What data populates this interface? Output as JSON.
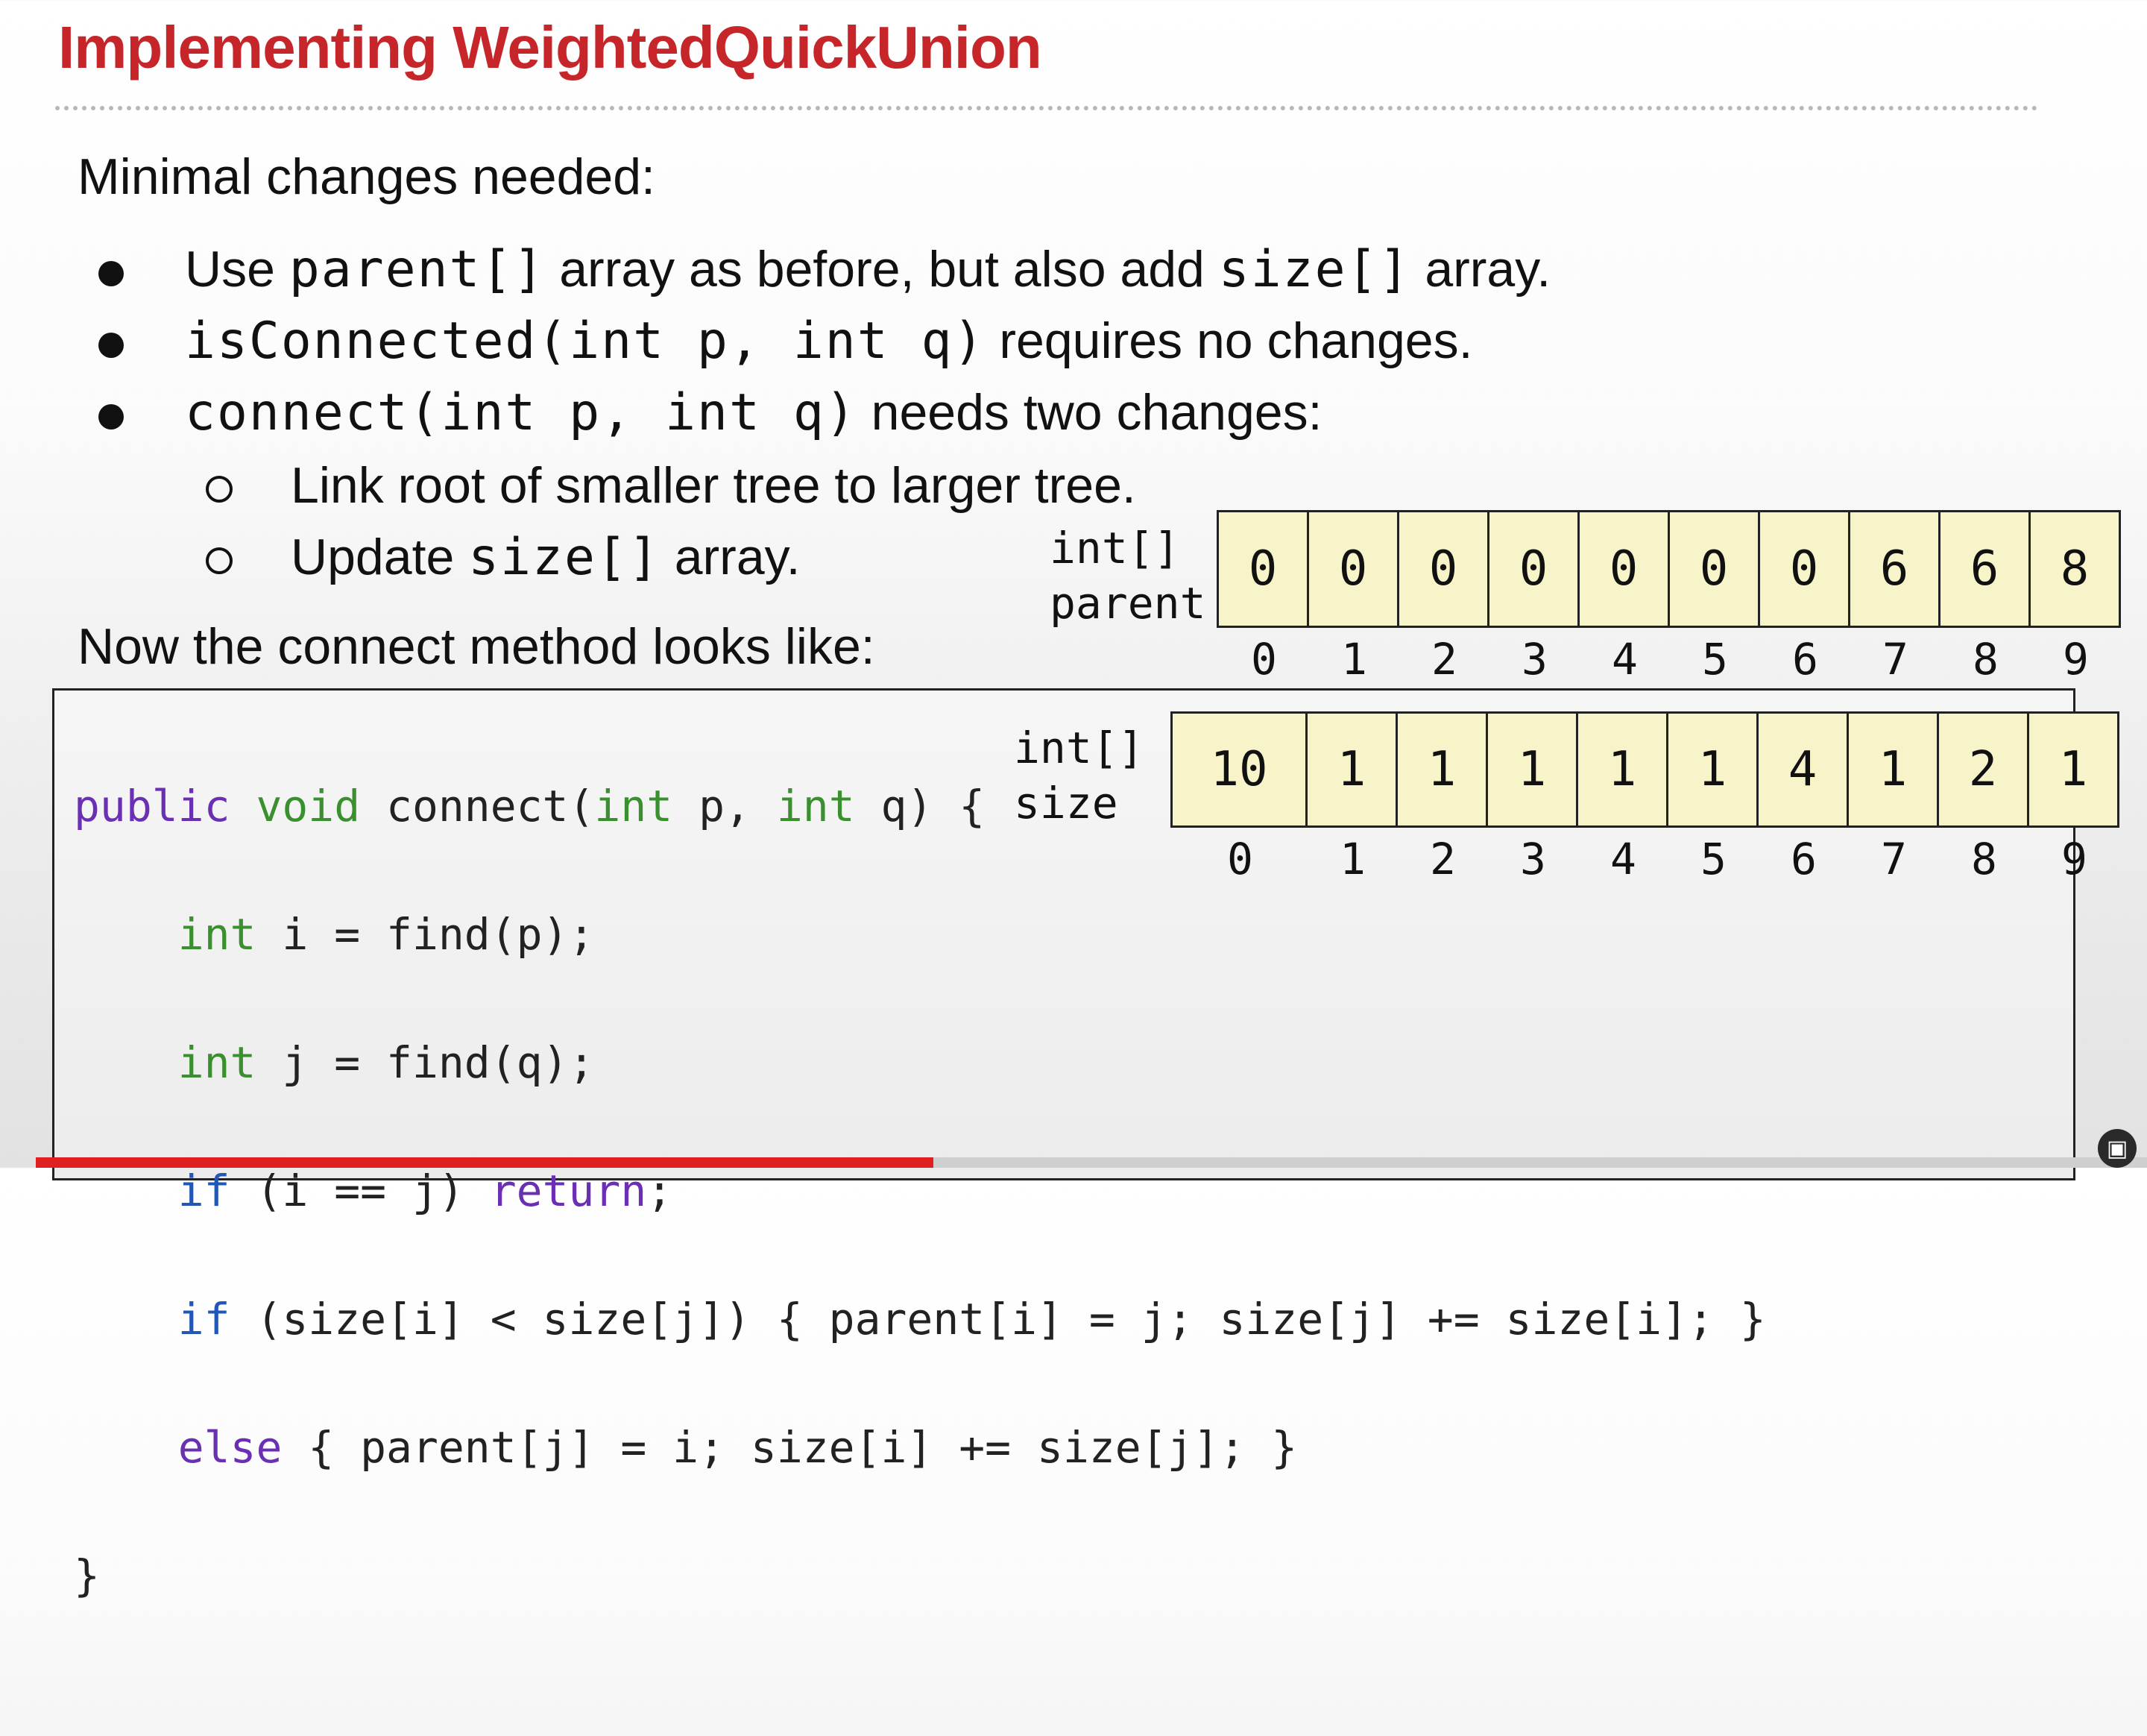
{
  "title": "Implementing WeightedQuickUnion",
  "intro": "Minimal changes needed:",
  "bullets": {
    "b1": {
      "t1": "Use ",
      "c1": "parent[]",
      "t2": " array as before, but also add ",
      "c2": "size[]",
      "t3": " array."
    },
    "b2": {
      "c1": "isConnected(int p, int q)",
      "t1": " requires no changes."
    },
    "b3": {
      "c1": "connect(int p, int q)",
      "t1": " needs two changes:"
    },
    "sub1": {
      "t1": "Link root of smaller tree to larger tree."
    },
    "sub2": {
      "t1": "Update ",
      "c1": "size[]",
      "t2": " array."
    }
  },
  "outro": "Now the connect method looks like:",
  "parent_array": {
    "type_label": "int[]",
    "name_label": "parent",
    "values": [
      "0",
      "0",
      "0",
      "0",
      "0",
      "0",
      "0",
      "6",
      "6",
      "8"
    ],
    "indices": [
      "0",
      "1",
      "2",
      "3",
      "4",
      "5",
      "6",
      "7",
      "8",
      "9"
    ]
  },
  "size_array": {
    "type_label": "int[]",
    "name_label": "size",
    "values": [
      "10",
      "1",
      "1",
      "1",
      "1",
      "1",
      "4",
      "1",
      "2",
      "1"
    ],
    "indices": [
      "0",
      "1",
      "2",
      "3",
      "4",
      "5",
      "6",
      "7",
      "8",
      "9"
    ]
  },
  "code": {
    "l1": {
      "kw1": "public",
      "ty1": "void",
      "t1": " connect(",
      "ty2": "int",
      "t2": " p, ",
      "ty3": "int",
      "t3": " q) {"
    },
    "l2": {
      "ty1": "int",
      "t1": " i = find(p);"
    },
    "l3": {
      "ty1": "int",
      "t1": " j = find(q);"
    },
    "l4": {
      "ctl1": "if",
      "t1": " (i == j) ",
      "kw1": "return",
      "t2": ";"
    },
    "l5": {
      "ctl1": "if",
      "t1": " (size[i] < size[j]) { parent[i] = j; size[j] += size[i]; }"
    },
    "l6": {
      "kw1": "else",
      "t1": " { parent[j] = i; size[i] += size[j]; }"
    },
    "l7": {
      "t1": "}"
    }
  },
  "player": {
    "progress": 0.425
  }
}
